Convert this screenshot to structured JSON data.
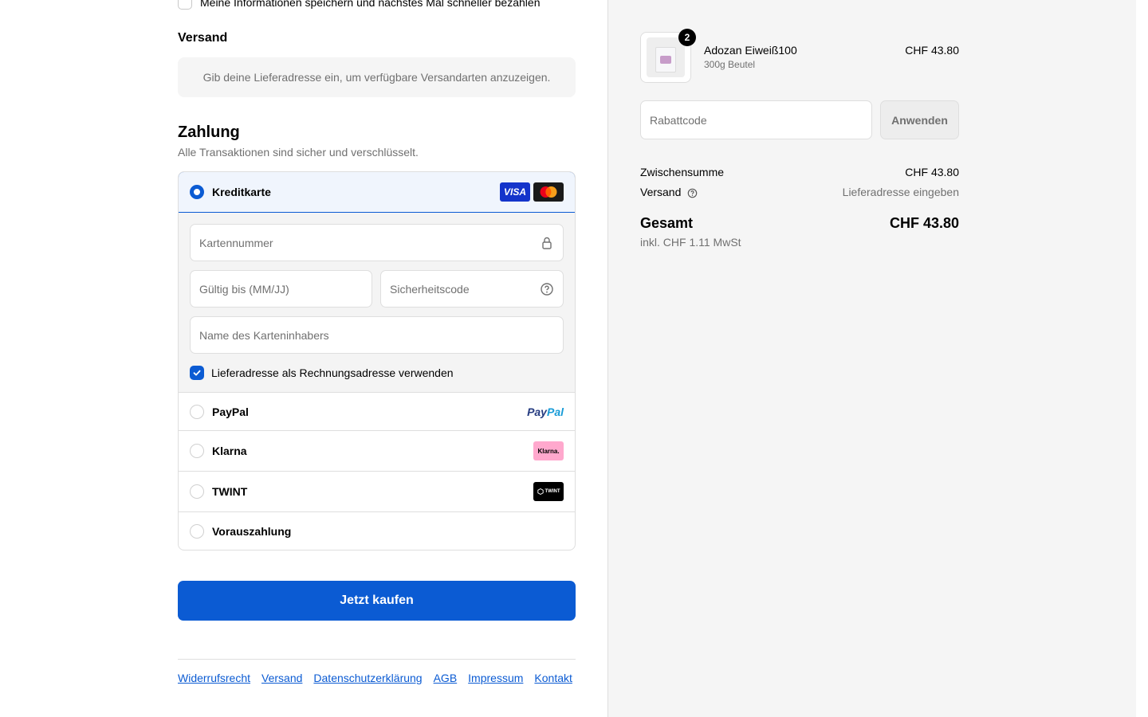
{
  "checkout": {
    "save_info_label": "Meine Informationen speichern und nächstes Mal schneller bezahlen",
    "shipping_heading": "Versand",
    "shipping_info": "Gib deine Lieferadresse ein, um verfügbare Versandarten anzuzeigen.",
    "payment_heading": "Zahlung",
    "payment_subtitle": "Alle Transaktionen sind sicher und verschlüsselt.",
    "payment_methods": [
      {
        "label": "Kreditkarte",
        "selected": true
      },
      {
        "label": "PayPal",
        "selected": false
      },
      {
        "label": "Klarna",
        "selected": false
      },
      {
        "label": "TWINT",
        "selected": false
      },
      {
        "label": "Vorauszahlung",
        "selected": false
      }
    ],
    "card_form": {
      "card_number_placeholder": "Kartennummer",
      "expiry_placeholder": "Gültig bis (MM/JJ)",
      "security_code_placeholder": "Sicherheitscode",
      "cardholder_placeholder": "Name des Karteninhabers",
      "billing_same_label": "Lieferadresse als Rechnungsadresse verwenden",
      "billing_same_checked": true
    },
    "brand_logos": {
      "visa": "VISA",
      "paypal_part1": "Pay",
      "paypal_part2": "Pal",
      "klarna": "Klarna.",
      "twint": "TWINT"
    },
    "buy_button": "Jetzt kaufen",
    "footer_links": [
      "Widerrufsrecht",
      "Versand",
      "Datenschutzerklärung",
      "AGB",
      "Impressum",
      "Kontakt"
    ]
  },
  "summary": {
    "product": {
      "name": "Adozan Eiweiß100",
      "variant": "300g Beutel",
      "price": "CHF 43.80",
      "quantity": "2"
    },
    "discount_placeholder": "Rabattcode",
    "apply_button": "Anwenden",
    "subtotal_label": "Zwischensumme",
    "subtotal_value": "CHF 43.80",
    "shipping_label": "Versand",
    "shipping_value": "Lieferadresse eingeben",
    "total_label": "Gesamt",
    "total_value": "CHF 43.80",
    "tax_note": "inkl. CHF 1.11 MwSt"
  },
  "colors": {
    "accent": "#0b5bd3",
    "muted_text": "#707070",
    "border": "#dedede",
    "summary_bg": "#f5f5f5"
  }
}
